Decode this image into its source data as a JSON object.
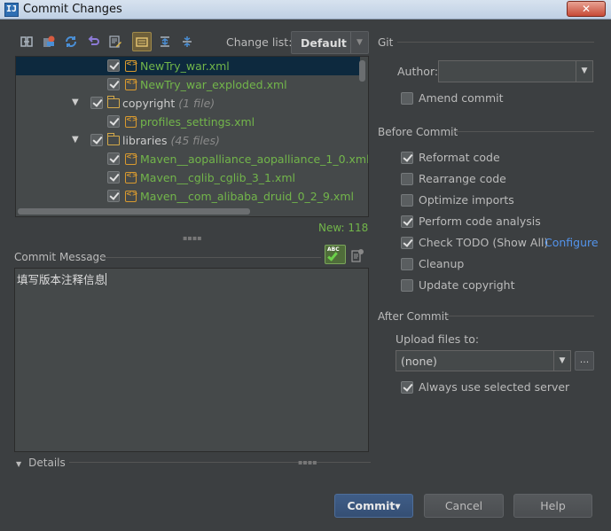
{
  "window": {
    "title": "Commit Changes",
    "app_icon": "IJ",
    "close_glyph": "✕"
  },
  "toolbar": {
    "icons": [
      "compare-icon",
      "refresh-changes-icon",
      "sync-icon",
      "revert-icon",
      "edit-source-icon",
      "group-by-directory-icon",
      "expand-all-icon",
      "collapse-all-icon"
    ],
    "changelist_label": "Change list:",
    "changelist_value": "Default"
  },
  "tree": {
    "rows": [
      {
        "kind": "file",
        "name": "NewTry_war.xml",
        "selected": true
      },
      {
        "kind": "file",
        "name": "NewTry_war_exploded.xml"
      },
      {
        "kind": "dir",
        "name": "copyright",
        "count": "(1 file)"
      },
      {
        "kind": "file",
        "name": "profiles_settings.xml"
      },
      {
        "kind": "dir",
        "name": "libraries",
        "count": "(45 files)"
      },
      {
        "kind": "file",
        "name": "Maven__aopalliance_aopalliance_1_0.xml"
      },
      {
        "kind": "file",
        "name": "Maven__cglib_cglib_3_1.xml"
      },
      {
        "kind": "file",
        "name": "Maven__com_alibaba_druid_0_2_9.xml"
      }
    ],
    "new_count": "New: 118"
  },
  "commit_message": {
    "label": "Commit Message",
    "text": "填写版本注释信息",
    "spell_label": "ABC"
  },
  "details": {
    "label": "Details"
  },
  "git": {
    "section_label": "Git",
    "author_label": "Author:",
    "author_value": "",
    "amend_label": "Amend commit"
  },
  "before_commit": {
    "section_label": "Before Commit",
    "options": [
      {
        "label": "Reformat code",
        "checked": true
      },
      {
        "label": "Rearrange code",
        "checked": false
      },
      {
        "label": "Optimize imports",
        "checked": false
      },
      {
        "label": "Perform code analysis",
        "checked": true
      },
      {
        "label": "Check TODO (Show All)",
        "checked": true
      },
      {
        "label": "Cleanup",
        "checked": false
      },
      {
        "label": "Update copyright",
        "checked": false
      }
    ],
    "configure_link": "Configure"
  },
  "after_commit": {
    "section_label": "After Commit",
    "upload_label": "Upload files to:",
    "upload_value": "(none)",
    "ellipsis": "...",
    "always_use_label": "Always use selected server",
    "always_use_checked": true
  },
  "buttons": {
    "commit": "Commit",
    "commit_arrow": "▾",
    "cancel": "Cancel",
    "help": "Help"
  },
  "colors": {
    "background": "#3c3f41",
    "added_file": "#72b54a",
    "link": "#5394ec",
    "selection": "#0d293e"
  }
}
